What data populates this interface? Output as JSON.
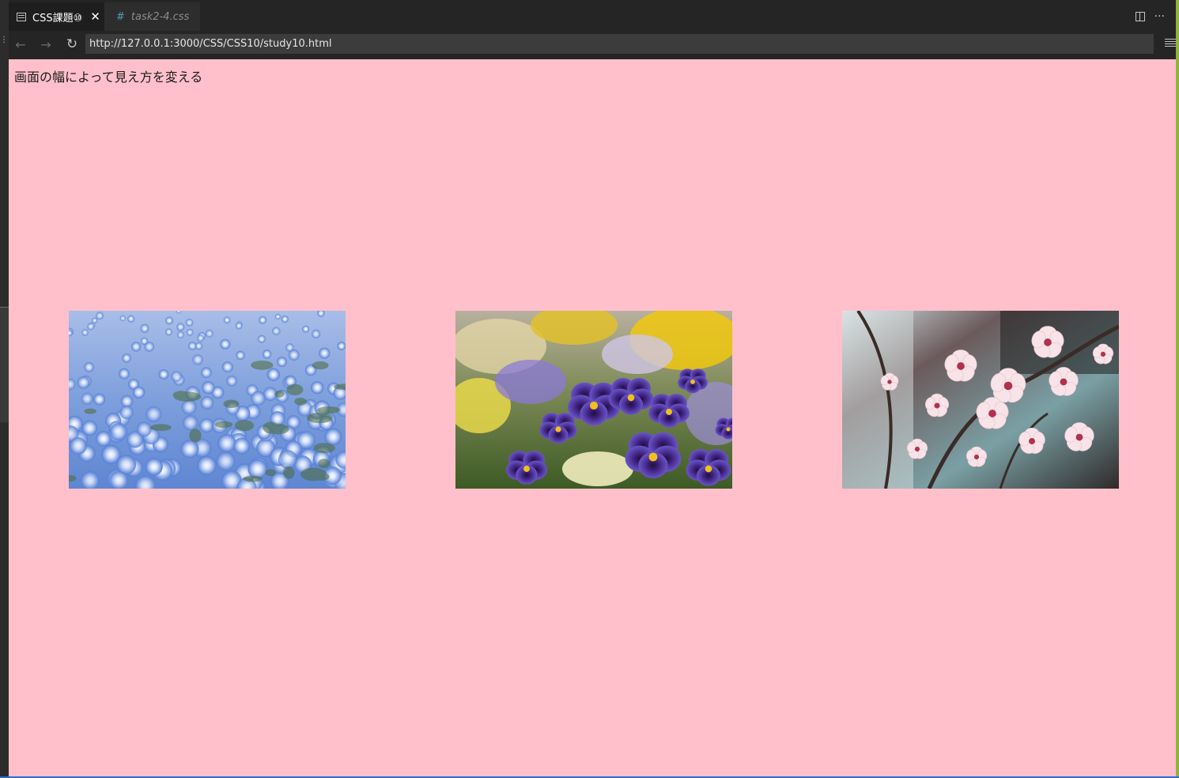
{
  "tabs": [
    {
      "label": "CSS課題⑩",
      "icon": "preview-icon",
      "active": true
    },
    {
      "label": "task2-4.css",
      "icon": "css-hash-icon",
      "active": false
    }
  ],
  "tab_close_glyph": "✕",
  "address_bar": {
    "url": "http://127.0.0.1:3000/CSS/CSS10/study10.html"
  },
  "page": {
    "background": "#ffc0cb",
    "heading": "画面の幅によって見え方を変える",
    "images": [
      {
        "subject": "blue nemophila flowers"
      },
      {
        "subject": "purple and yellow pansies"
      },
      {
        "subject": "pink cherry blossoms"
      }
    ]
  }
}
